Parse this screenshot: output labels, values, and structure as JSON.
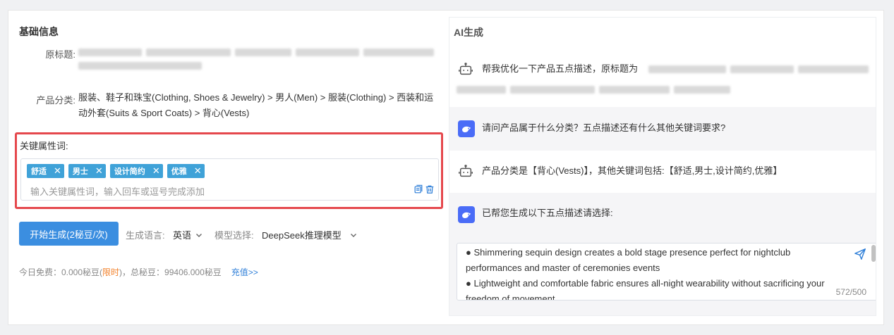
{
  "basic": {
    "section_title": "基础信息",
    "title_label": "原标题:",
    "category_label": "产品分类:",
    "category_value": "服装、鞋子和珠宝(Clothing, Shoes & Jewelry) > 男人(Men) > 服装(Clothing) > 西装和运动外套(Suits & Sport Coats) > 背心(Vests)",
    "keywords_label": "关键属性词:",
    "keywords": [
      "舒适",
      "男士",
      "设计简约",
      "优雅"
    ],
    "keywords_placeholder": "输入关键属性词，输入回车或逗号完成添加",
    "generate_button": "开始生成(2秘豆/次)",
    "language_label": "生成语言:",
    "language_value": "英语",
    "model_label": "模型选择:",
    "model_value": "DeepSeek推理模型",
    "footer_prefix": "今日免费：0.000秘豆(",
    "footer_highlight": "限时",
    "footer_suffix": ")，总秘豆：99406.000秘豆",
    "recharge_link": "充值>>"
  },
  "ai": {
    "section_title": "AI生成",
    "messages": [
      {
        "role": "user",
        "text": "帮我优化一下产品五点描述，原标题为"
      },
      {
        "role": "ai",
        "text": "请问产品属于什么分类？五点描述还有什么其他关键词要求?"
      },
      {
        "role": "user",
        "text": "产品分类是【背心(Vests)】，其他关键词包括:【舒适,男士,设计简约,优雅】"
      },
      {
        "role": "ai",
        "text": "已帮您生成以下五点描述请选择:"
      }
    ],
    "output_lines": [
      "● Shimmering sequin design creates a bold stage presence perfect for nightclub performances and master of ceremonies events",
      "● Lightweight and comfortable fabric ensures all-night wearability without sacrificing your freedom of movement"
    ],
    "char_count": "572/500"
  },
  "icons": {
    "user": "robot-icon",
    "ai": "deepseek-whale-icon",
    "send": "send-icon",
    "copy": "copy-icon",
    "delete": "trash-icon"
  },
  "colors": {
    "accent": "#3b8ee0",
    "tag": "#3fa2d8",
    "highlight_border": "#e5484d",
    "warning": "#f2812a",
    "ai_avatar": "#4a6cf7"
  }
}
